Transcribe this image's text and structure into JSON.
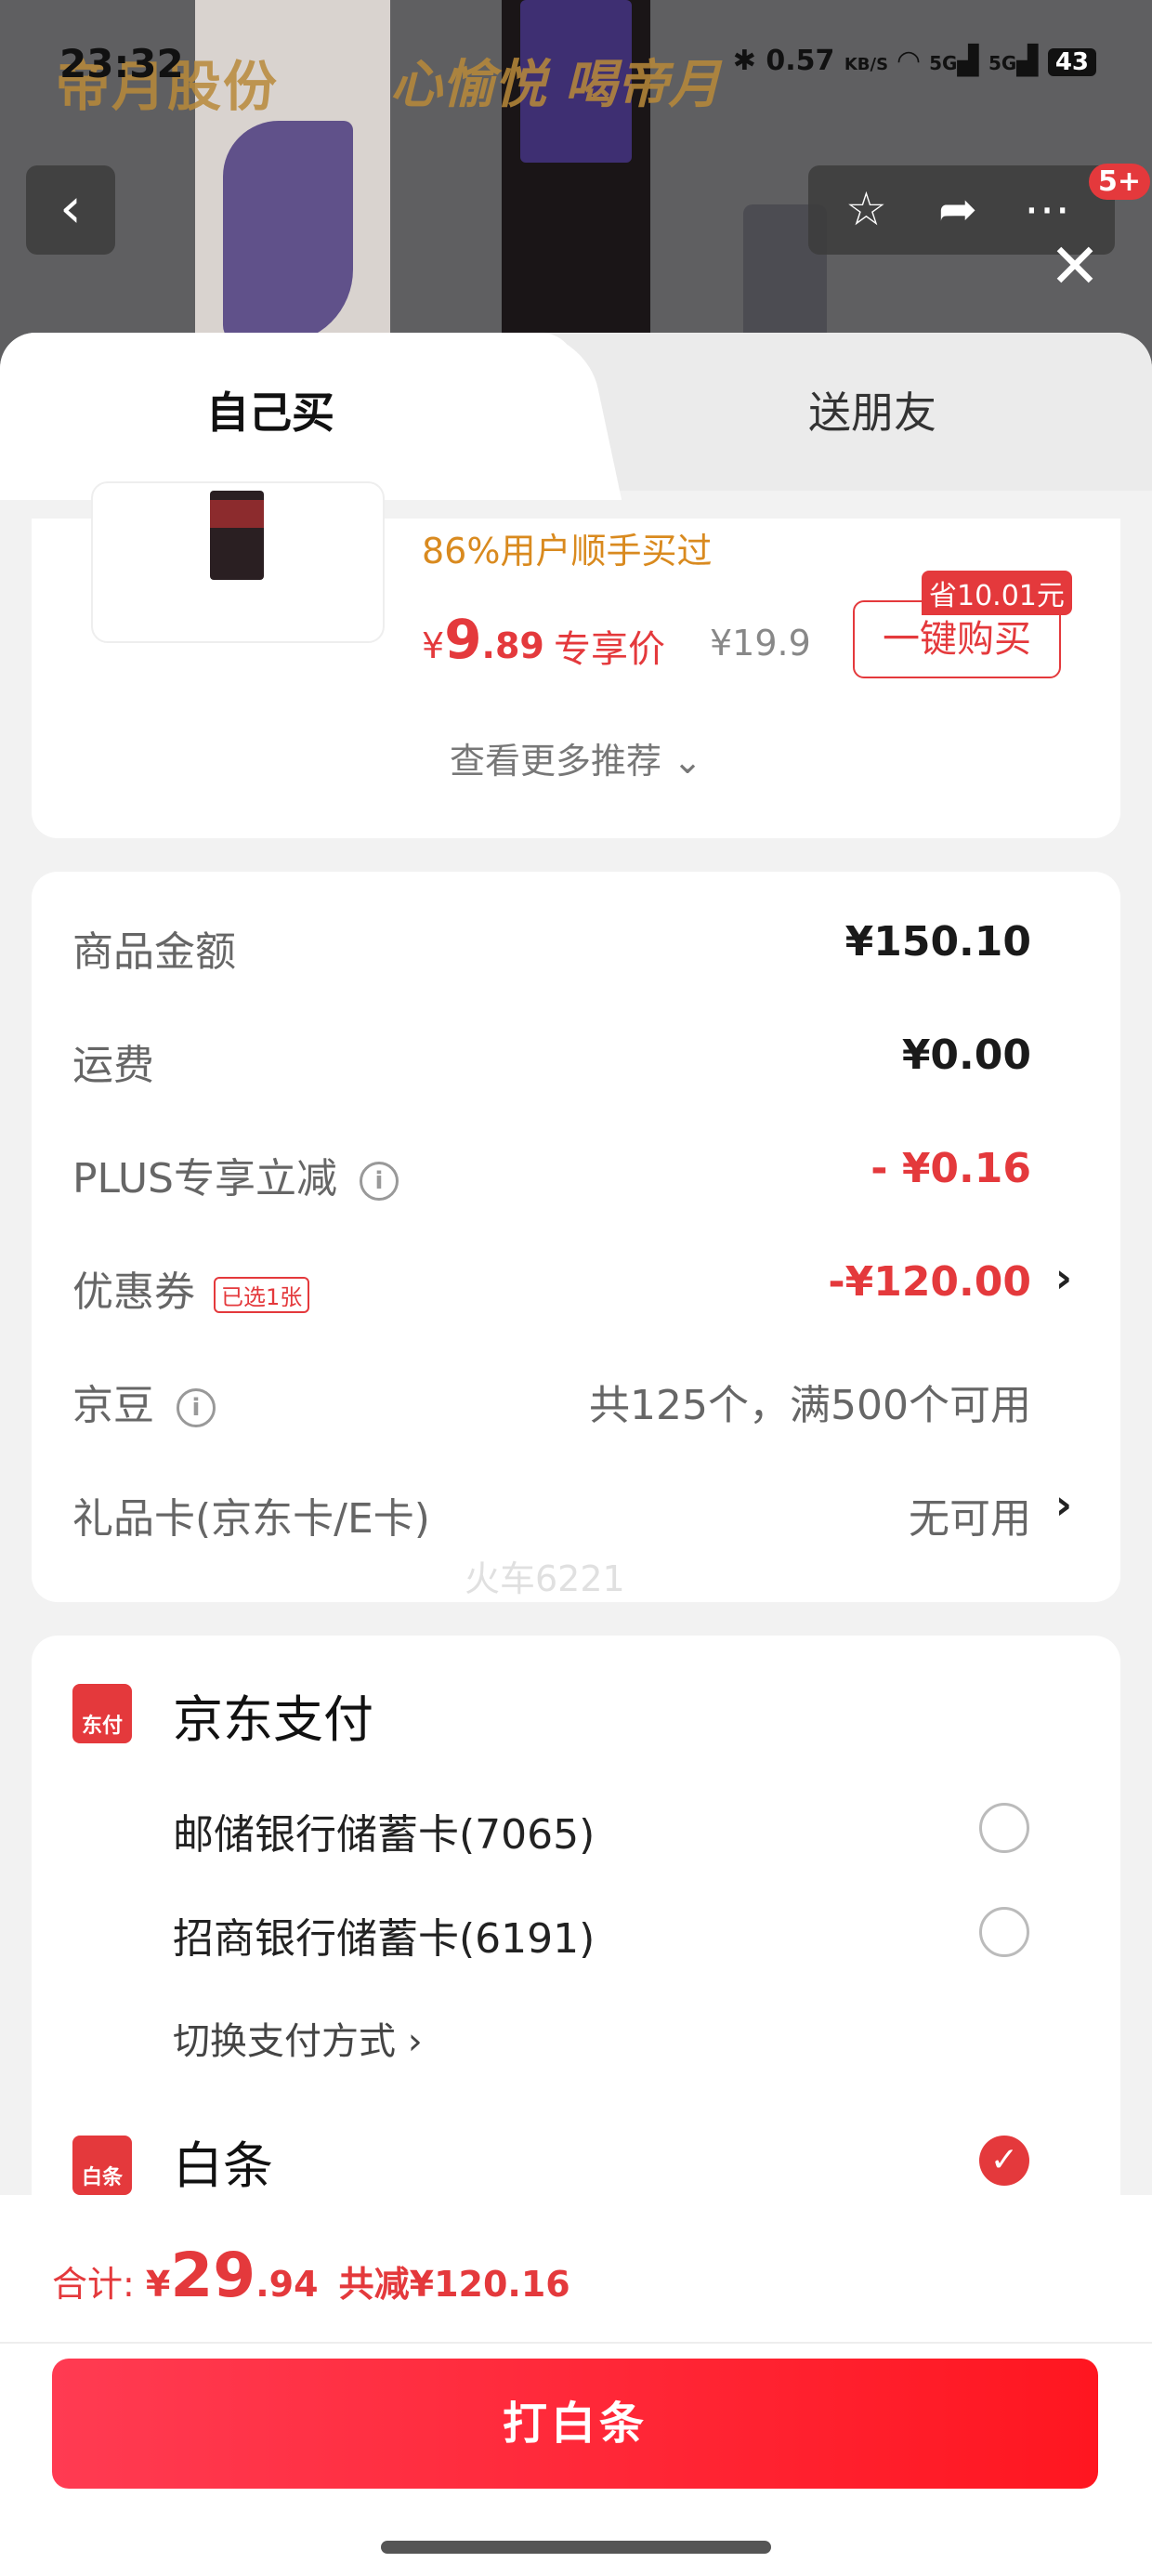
{
  "status_bar": {
    "time": "23:32",
    "net_speed": "0.57",
    "net_unit": "KB/S",
    "signal1": "5G",
    "signal2": "5G",
    "battery": "43"
  },
  "hero": {
    "brand_left": "帝月股份",
    "brand_right": "心愉悦 喝帝月",
    "notification_badge": "5+"
  },
  "tabs": {
    "self": "自己买",
    "friend": "送朋友"
  },
  "recommend": {
    "percent_text": "86%用户顺手买过",
    "price_currency": "¥",
    "price_int": "9",
    "price_dec": ".89",
    "price_label": "专享价",
    "old_price": "¥19.9",
    "save_tag": "省10.01元",
    "buy_label": "一键购买",
    "see_more": "查看更多推荐"
  },
  "fees": {
    "goods_label": "商品金额",
    "goods_value": "¥150.10",
    "shipping_label": "运费",
    "shipping_value": "¥0.00",
    "plus_label": "PLUS专享立减",
    "plus_value": "- ¥0.16",
    "coupon_label": "优惠券",
    "coupon_tag": "已选1张",
    "coupon_value": "-¥120.00",
    "beans_label": "京豆",
    "beans_value": "共125个，满500个可用",
    "giftcard_label": "礼品卡(京东卡/E卡)",
    "giftcard_value": "无可用"
  },
  "watermark": "火车6221",
  "payment": {
    "jd_icon": "东付",
    "jd_title": "京东支付",
    "card1": "邮储银行储蓄卡(7065)",
    "card2": "招商银行储蓄卡(6191)",
    "switch": "切换支付方式",
    "baitiao_icon": "白条",
    "baitiao_title": "白条"
  },
  "footer": {
    "total_label": "合计:",
    "currency": "¥",
    "total_int": "29",
    "total_dec": ".94",
    "saved": "共减¥120.16",
    "pay_button": "打白条"
  },
  "colors": {
    "accent": "#e4393c",
    "orange": "#d98a1f"
  }
}
